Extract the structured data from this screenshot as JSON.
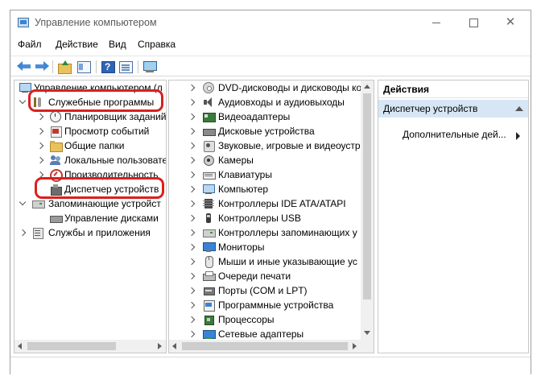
{
  "window": {
    "title": "Управление компьютером",
    "controls": {
      "minimize": "minimize",
      "maximize": "maximize",
      "close": "✕"
    }
  },
  "menubar": {
    "items": [
      "Файл",
      "Действие",
      "Вид",
      "Справка"
    ]
  },
  "toolbar": {
    "icons": [
      "arrow-left-icon",
      "arrow-right-icon",
      "folder-up-icon",
      "show-tree-icon",
      "help-icon",
      "properties-icon",
      "monitor-icon"
    ]
  },
  "tree": {
    "root": "Управление компьютером (л",
    "tools": "Служебные программы",
    "scheduler": "Планировщик заданий",
    "events": "Просмотр событий",
    "shared": "Общие папки",
    "local_users": "Локальные пользовате",
    "performance": "Производительность",
    "device_manager": "Диспетчер устройств",
    "storage": "Запоминающие устройст",
    "disk_mgmt": "Управление дисками",
    "services": "Службы и приложения"
  },
  "devices": {
    "items": [
      "DVD-дисководы и дисководы ко",
      "Аудиовходы и аудиовыходы",
      "Видеоадаптеры",
      "Дисковые устройства",
      "Звуковые, игровые и видеоустр",
      "Камеры",
      "Клавиатуры",
      "Компьютер",
      "Контроллеры IDE ATA/ATAPI",
      "Контроллеры USB",
      "Контроллеры запоминающих у",
      "Мониторы",
      "Мыши и иные указывающие ус",
      "Очереди печати",
      "Порты (COM и LPT)",
      "Программные устройства",
      "Процессоры",
      "Сетевые адаптеры"
    ]
  },
  "actions": {
    "header": "Действия",
    "group": "Диспетчер устройств",
    "more": "Дополнительные дей..."
  },
  "colors": {
    "highlight": "#d92020",
    "selection": "#d6e6f5"
  }
}
